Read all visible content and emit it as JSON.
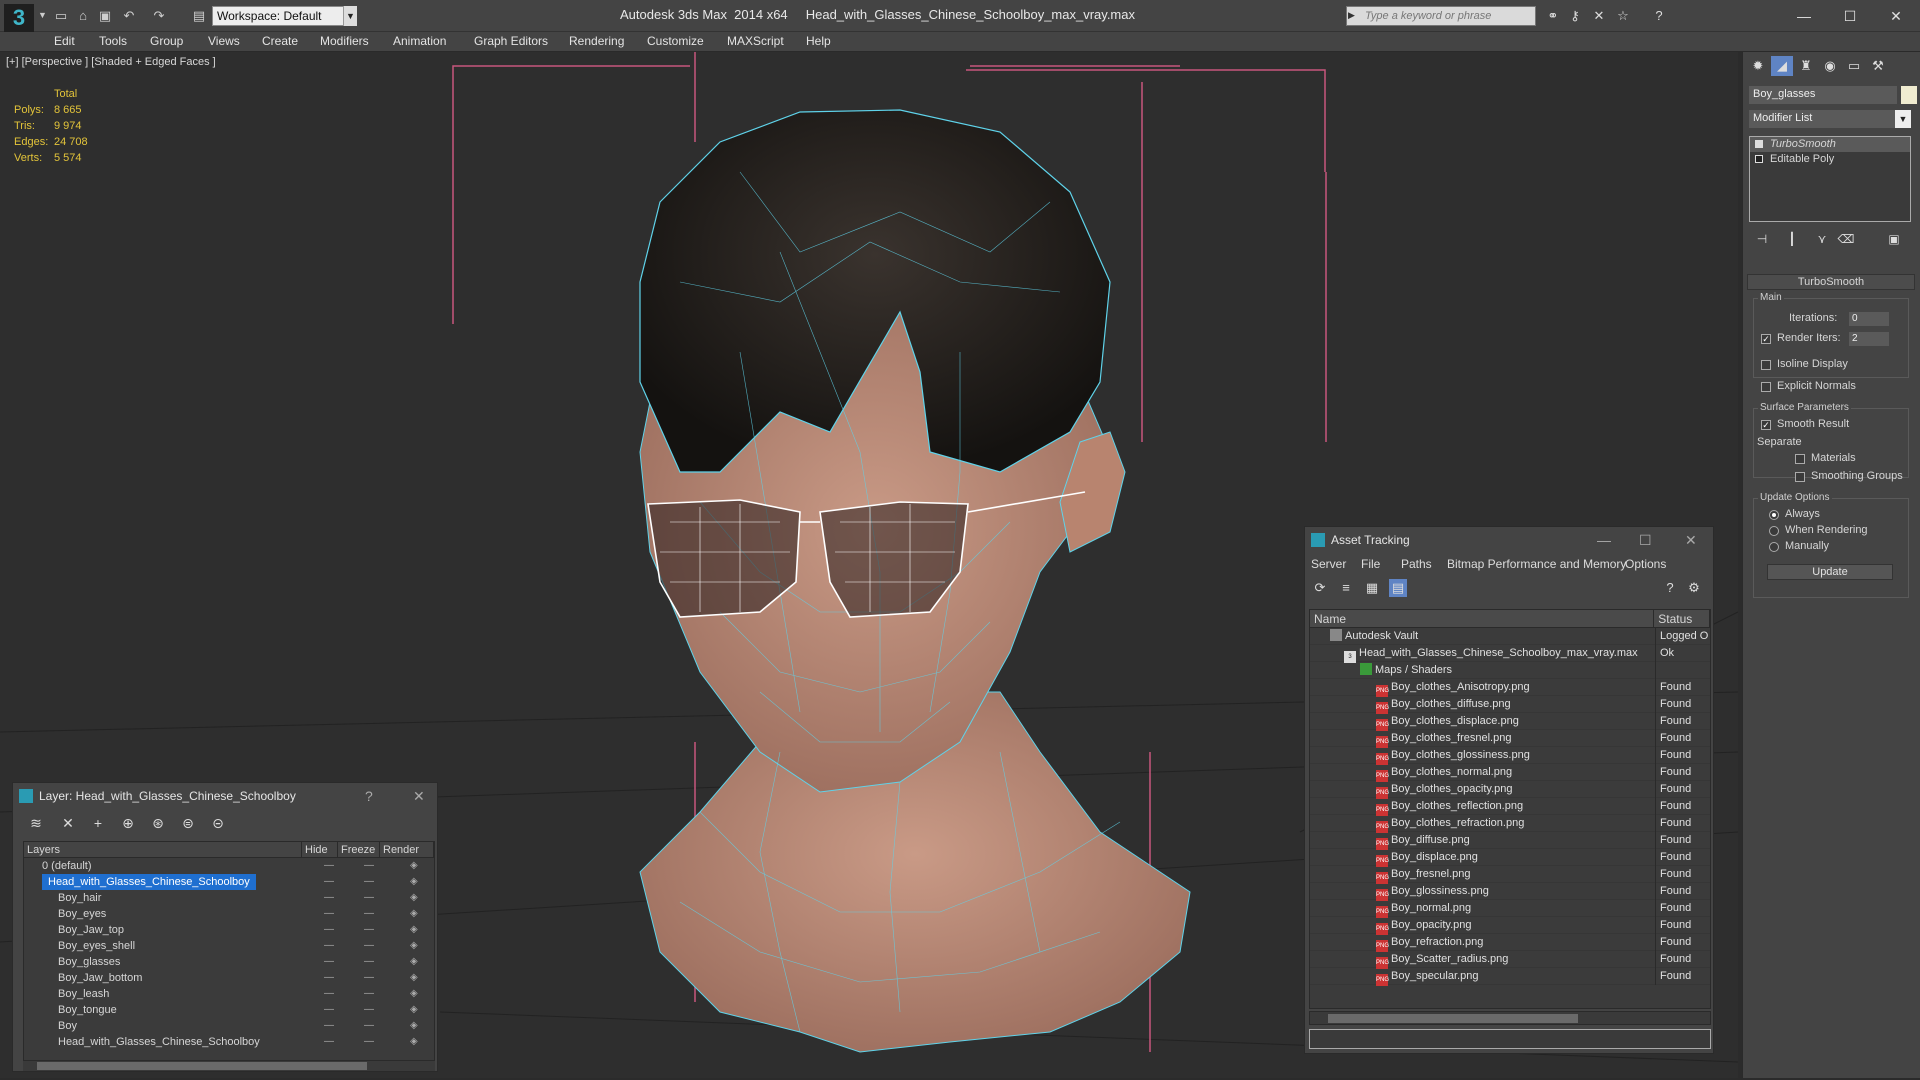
{
  "app": {
    "title": "Autodesk 3ds Max  2014 x64     Head_with_Glasses_Chinese_Schoolboy_max_vray.max",
    "workspace": "Workspace: Default",
    "search_placeholder": "Type a keyword or phrase"
  },
  "menu": [
    "Edit",
    "Tools",
    "Group",
    "Views",
    "Create",
    "Modifiers",
    "Animation",
    "Graph Editors",
    "Rendering",
    "Customize",
    "MAXScript",
    "Help"
  ],
  "viewport": {
    "label": "[+] [Perspective ] [Shaded + Edged Faces ]",
    "stats": {
      "header": "Total",
      "rows": [
        {
          "k": "Polys:",
          "v": "8 665"
        },
        {
          "k": "Tris:",
          "v": "9 974"
        },
        {
          "k": "Edges:",
          "v": "24 708"
        },
        {
          "k": "Verts:",
          "v": "5 574"
        }
      ]
    }
  },
  "layer_panel": {
    "title": "Layer: Head_with_Glasses_Chinese_Schoolboy",
    "help": "?",
    "columns": [
      "Layers",
      "Hide",
      "Freeze",
      "Render"
    ],
    "rows": [
      {
        "name": "0 (default)",
        "indent": 1
      },
      {
        "name": "Head_with_Glasses_Chinese_Schoolboy",
        "indent": 1,
        "selected": true
      },
      {
        "name": "Boy_hair",
        "indent": 2
      },
      {
        "name": "Boy_eyes",
        "indent": 2
      },
      {
        "name": "Boy_Jaw_top",
        "indent": 2
      },
      {
        "name": "Boy_eyes_shell",
        "indent": 2
      },
      {
        "name": "Boy_glasses",
        "indent": 2
      },
      {
        "name": "Boy_Jaw_bottom",
        "indent": 2
      },
      {
        "name": "Boy_leash",
        "indent": 2
      },
      {
        "name": "Boy_tongue",
        "indent": 2
      },
      {
        "name": "Boy",
        "indent": 2
      },
      {
        "name": "Head_with_Glasses_Chinese_Schoolboy",
        "indent": 2
      }
    ]
  },
  "asset_panel": {
    "title": "Asset Tracking",
    "menu": [
      "Server",
      "File",
      "Paths",
      "Bitmap Performance and Memory",
      "Options"
    ],
    "columns": [
      "Name",
      "Status"
    ],
    "rows": [
      {
        "name": "Autodesk Vault",
        "status": "Logged O",
        "indent": 1,
        "kind": "vault"
      },
      {
        "name": "Head_with_Glasses_Chinese_Schoolboy_max_vray.max",
        "status": "Ok",
        "indent": 2,
        "kind": "max"
      },
      {
        "name": "Maps / Shaders",
        "status": "",
        "indent": 3,
        "kind": "folder"
      },
      {
        "name": "Boy_clothes_Anisotropy.png",
        "status": "Found",
        "indent": 4,
        "kind": "png"
      },
      {
        "name": "Boy_clothes_diffuse.png",
        "status": "Found",
        "indent": 4,
        "kind": "png"
      },
      {
        "name": "Boy_clothes_displace.png",
        "status": "Found",
        "indent": 4,
        "kind": "png"
      },
      {
        "name": "Boy_clothes_fresnel.png",
        "status": "Found",
        "indent": 4,
        "kind": "png"
      },
      {
        "name": "Boy_clothes_glossiness.png",
        "status": "Found",
        "indent": 4,
        "kind": "png"
      },
      {
        "name": "Boy_clothes_normal.png",
        "status": "Found",
        "indent": 4,
        "kind": "png"
      },
      {
        "name": "Boy_clothes_opacity.png",
        "status": "Found",
        "indent": 4,
        "kind": "png"
      },
      {
        "name": "Boy_clothes_reflection.png",
        "status": "Found",
        "indent": 4,
        "kind": "png"
      },
      {
        "name": "Boy_clothes_refraction.png",
        "status": "Found",
        "indent": 4,
        "kind": "png"
      },
      {
        "name": "Boy_diffuse.png",
        "status": "Found",
        "indent": 4,
        "kind": "png"
      },
      {
        "name": "Boy_displace.png",
        "status": "Found",
        "indent": 4,
        "kind": "png"
      },
      {
        "name": "Boy_fresnel.png",
        "status": "Found",
        "indent": 4,
        "kind": "png"
      },
      {
        "name": "Boy_glossiness.png",
        "status": "Found",
        "indent": 4,
        "kind": "png"
      },
      {
        "name": "Boy_normal.png",
        "status": "Found",
        "indent": 4,
        "kind": "png"
      },
      {
        "name": "Boy_opacity.png",
        "status": "Found",
        "indent": 4,
        "kind": "png"
      },
      {
        "name": "Boy_refraction.png",
        "status": "Found",
        "indent": 4,
        "kind": "png"
      },
      {
        "name": "Boy_Scatter_radius.png",
        "status": "Found",
        "indent": 4,
        "kind": "png"
      },
      {
        "name": "Boy_specular.png",
        "status": "Found",
        "indent": 4,
        "kind": "png"
      }
    ]
  },
  "command_panel": {
    "object_name": "Boy_glasses",
    "object_color": "#f0ecd0",
    "modifier_list": "Modifier List",
    "stack": [
      "TurboSmooth",
      "Editable Poly"
    ],
    "rollout": "TurboSmooth",
    "main_label": "Main",
    "iterations_label": "Iterations:",
    "iterations_value": "0",
    "render_iters_label": "Render Iters:",
    "render_iters_value": "2",
    "isoline": "Isoline Display",
    "explicit": "Explicit Normals",
    "surface_params": "Surface Parameters",
    "smooth_result": "Smooth Result",
    "separate": "Separate",
    "materials": "Materials",
    "smoothing_groups": "Smoothing Groups",
    "update_options": "Update Options",
    "always": "Always",
    "when_rendering": "When Rendering",
    "manually": "Manually",
    "update_btn": "Update"
  }
}
